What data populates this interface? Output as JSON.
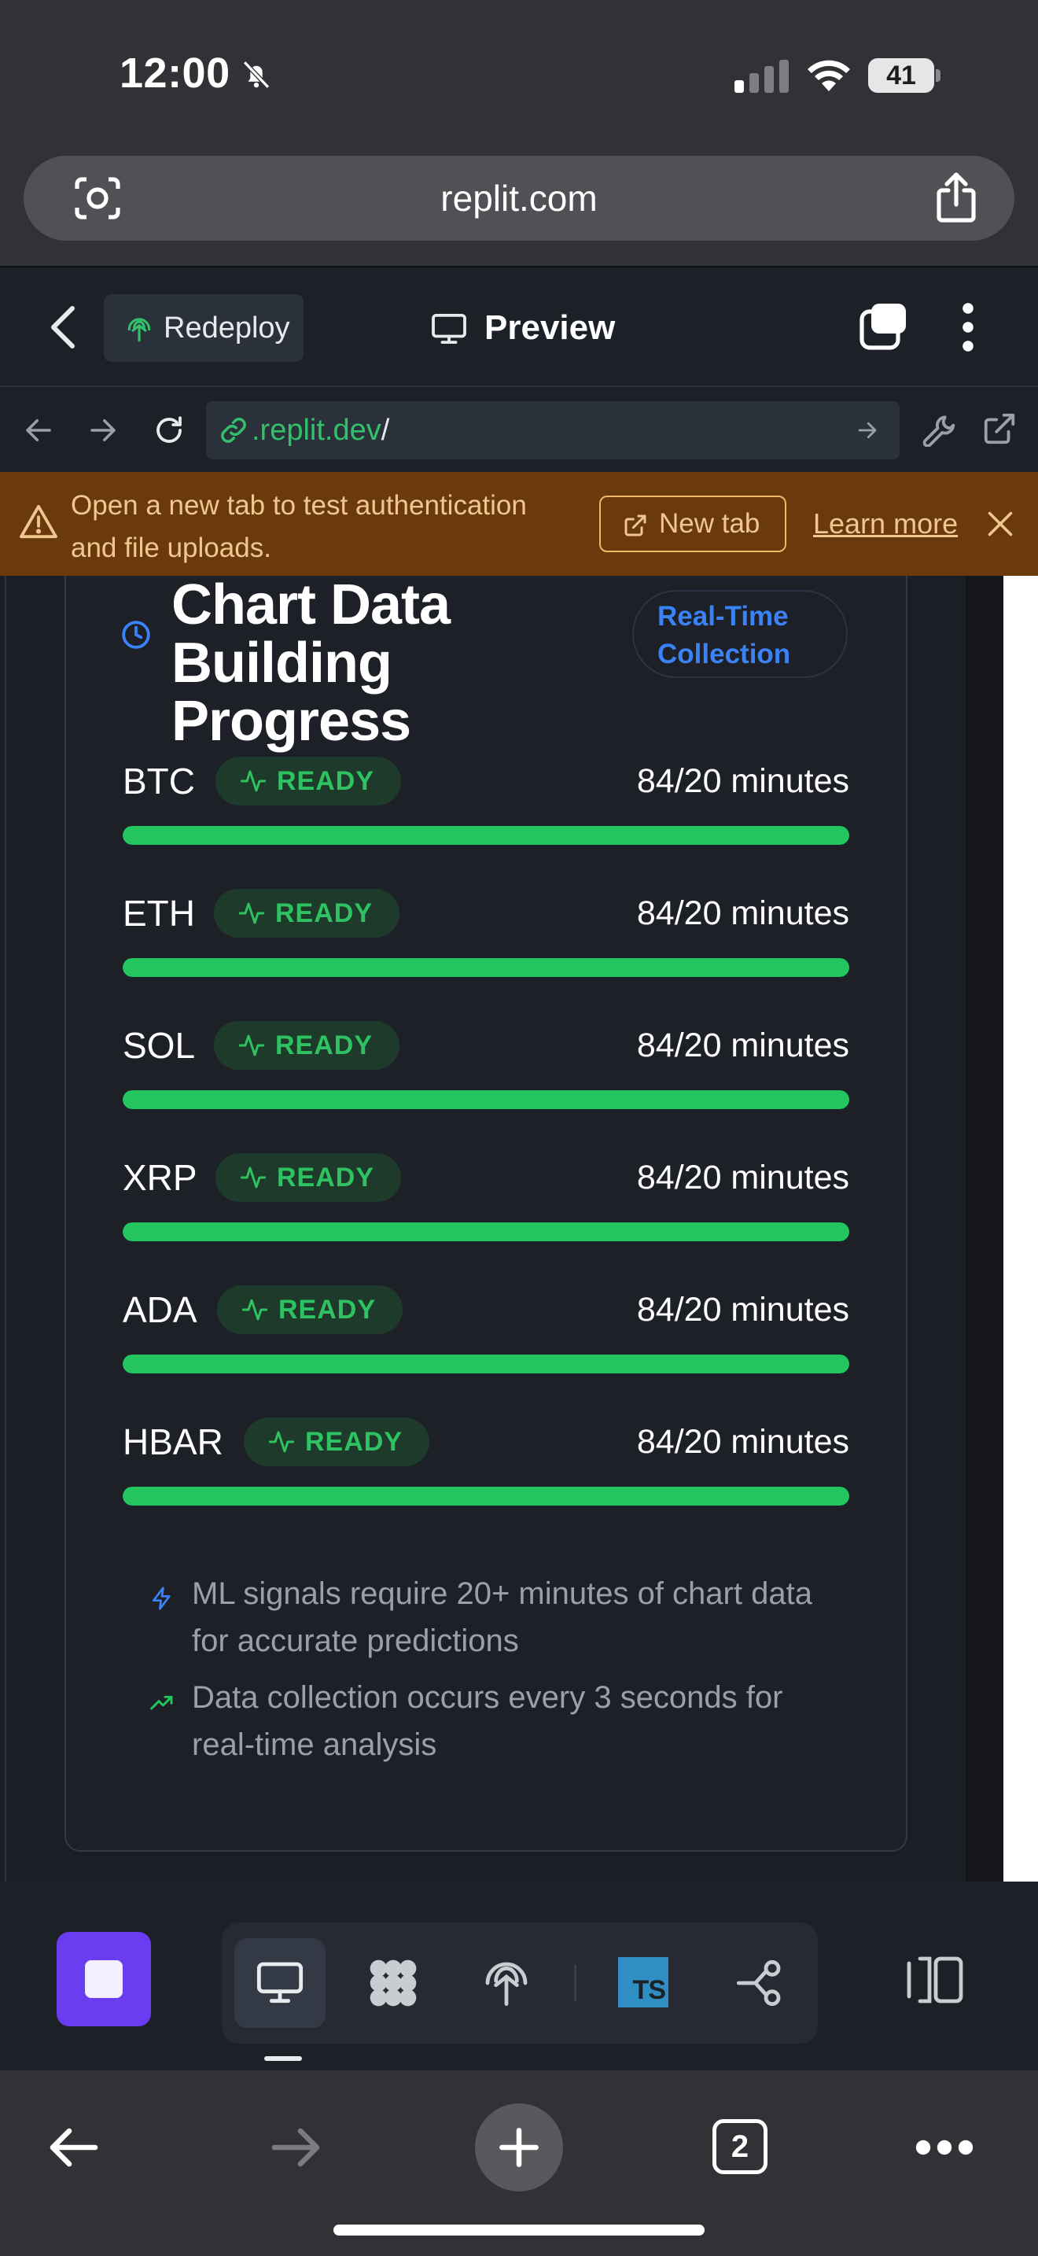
{
  "status_bar": {
    "time": "12:00",
    "battery": "41"
  },
  "safari": {
    "url": "replit.com",
    "open_tabs": "2"
  },
  "replit_header": {
    "redeploy_label": "Redeploy",
    "preview_label": "Preview"
  },
  "webview": {
    "host": ".replit.dev",
    "path": "/"
  },
  "banner": {
    "message": "Open a new tab to test authentication and file uploads.",
    "new_tab_label": "New tab",
    "learn_more_label": "Learn more"
  },
  "card": {
    "title": "Chart Data Building Progress",
    "badge": "Real-Time Collection",
    "rows": [
      {
        "symbol": "BTC",
        "status": "READY",
        "progress_text": "84/20 minutes",
        "progress": 1.0
      },
      {
        "symbol": "ETH",
        "status": "READY",
        "progress_text": "84/20 minutes",
        "progress": 1.0
      },
      {
        "symbol": "SOL",
        "status": "READY",
        "progress_text": "84/20 minutes",
        "progress": 1.0
      },
      {
        "symbol": "XRP",
        "status": "READY",
        "progress_text": "84/20 minutes",
        "progress": 1.0
      },
      {
        "symbol": "ADA",
        "status": "READY",
        "progress_text": "84/20 minutes",
        "progress": 1.0
      },
      {
        "symbol": "HBAR",
        "status": "READY",
        "progress_text": "84/20 minutes",
        "progress": 1.0
      }
    ],
    "notes": [
      {
        "icon": "zap-icon",
        "text": "ML signals require 20+ minutes of chart data for accurate predictions"
      },
      {
        "icon": "trending-up-icon",
        "text": "Data collection occurs every 3 seconds for real-time analysis"
      }
    ]
  },
  "toolbar": {
    "ts_label": "TS"
  },
  "colors": {
    "ready_green": "#22c55e",
    "badge_blue": "#3b82f6",
    "warning_bg": "#6b3a0c",
    "stop_purple": "#6a3ef0"
  }
}
